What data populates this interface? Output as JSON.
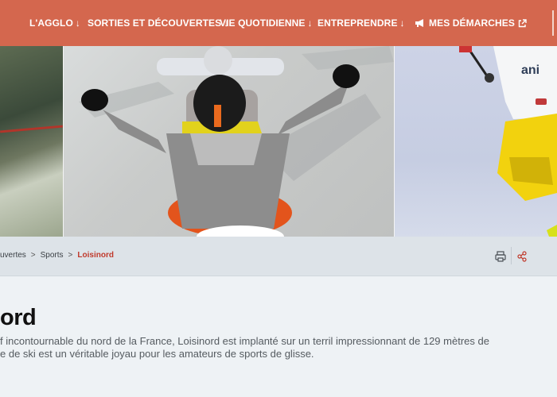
{
  "nav": {
    "items": [
      {
        "label": "L'AGGLO"
      },
      {
        "label": "SORTIES ET DÉCOUVERTES"
      },
      {
        "label": "VIE QUOTIDIENNE"
      },
      {
        "label": "ENTREPRENDRE"
      }
    ],
    "demarches": {
      "label": "MES DÉMARCHES"
    },
    "arrow_glyph": "↓"
  },
  "breadcrumb": {
    "items": [
      "uvertes",
      "Sports"
    ],
    "current": "Loisinord",
    "separator": ">"
  },
  "page": {
    "title": "ord",
    "intro_lines": [
      "f incontournable du nord de la France, Loisinord est implanté sur un terril impressionnant de 129 mètres de",
      "e de ski est un véritable joyau pour les amateurs de sports de glisse."
    ]
  },
  "colors": {
    "nav_bg": "#d4674e",
    "breadcrumb_current": "#c0392b",
    "page_bg": "#eef2f5"
  }
}
